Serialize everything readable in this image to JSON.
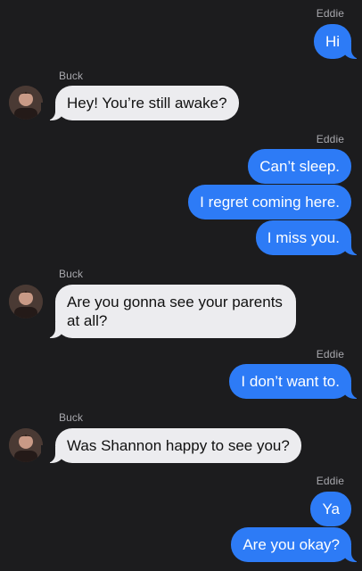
{
  "contacts": {
    "me": "Eddie",
    "them": "Buck"
  },
  "messages": [
    {
      "from": "Eddie",
      "text": "Hi"
    },
    {
      "from": "Buck",
      "text": "Hey! You’re still awake?"
    },
    {
      "from": "Eddie",
      "text": "Can’t sleep."
    },
    {
      "from": "Eddie",
      "text": "I regret coming here."
    },
    {
      "from": "Eddie",
      "text": "I miss you."
    },
    {
      "from": "Buck",
      "text": "Are you gonna see your parents at all?"
    },
    {
      "from": "Eddie",
      "text": "I don’t want to."
    },
    {
      "from": "Buck",
      "text": "Was Shannon happy to see you?"
    },
    {
      "from": "Eddie",
      "text": "Ya"
    },
    {
      "from": "Eddie",
      "text": "Are you okay?"
    }
  ],
  "colors": {
    "background": "#1c1c1e",
    "outgoing_bubble": "#2d7bf6",
    "incoming_bubble": "#ececef",
    "sender_label": "#a8a8ad"
  },
  "icons": {
    "avatar": "buck-avatar-photo"
  }
}
